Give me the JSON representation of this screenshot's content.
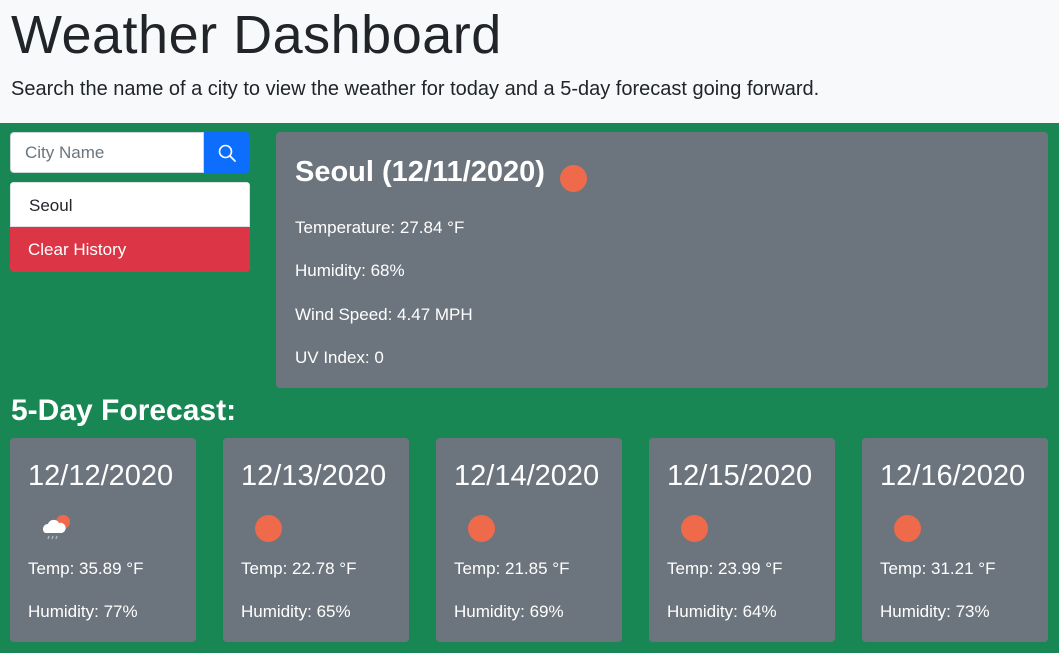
{
  "header": {
    "title": "Weather Dashboard",
    "subtitle": "Search the name of a city to view the weather for today and a 5-day forecast going forward."
  },
  "search": {
    "placeholder": "City Name",
    "button_icon": "search-icon"
  },
  "history": {
    "items": [
      "Seoul"
    ],
    "clear_label": "Clear History"
  },
  "current": {
    "title": "Seoul (12/11/2020)",
    "icon": "clear-sky-icon",
    "temperature": "Temperature: 27.84 °F",
    "humidity": "Humidity: 68%",
    "wind": "Wind Speed: 4.47 MPH",
    "uv": "UV Index: 0"
  },
  "forecast": {
    "title": "5-Day Forecast:",
    "days": [
      {
        "date": "12/12/2020",
        "icon": "rain-cloud-sun-icon",
        "temp": "Temp: 35.89 °F",
        "humidity": "Humidity: 77%"
      },
      {
        "date": "12/13/2020",
        "icon": "clear-sky-icon",
        "temp": "Temp: 22.78 °F",
        "humidity": "Humidity: 65%"
      },
      {
        "date": "12/14/2020",
        "icon": "clear-sky-icon",
        "temp": "Temp: 21.85 °F",
        "humidity": "Humidity: 69%"
      },
      {
        "date": "12/15/2020",
        "icon": "clear-sky-icon",
        "temp": "Temp: 23.99 °F",
        "humidity": "Humidity: 64%"
      },
      {
        "date": "12/16/2020",
        "icon": "clear-sky-icon",
        "temp": "Temp: 31.21 °F",
        "humidity": "Humidity: 73%"
      }
    ]
  },
  "colors": {
    "background": "#198754",
    "card": "#6c757d",
    "sun": "#ee6a4b",
    "search_button": "#0d6efd",
    "clear_button": "#dc3545"
  }
}
